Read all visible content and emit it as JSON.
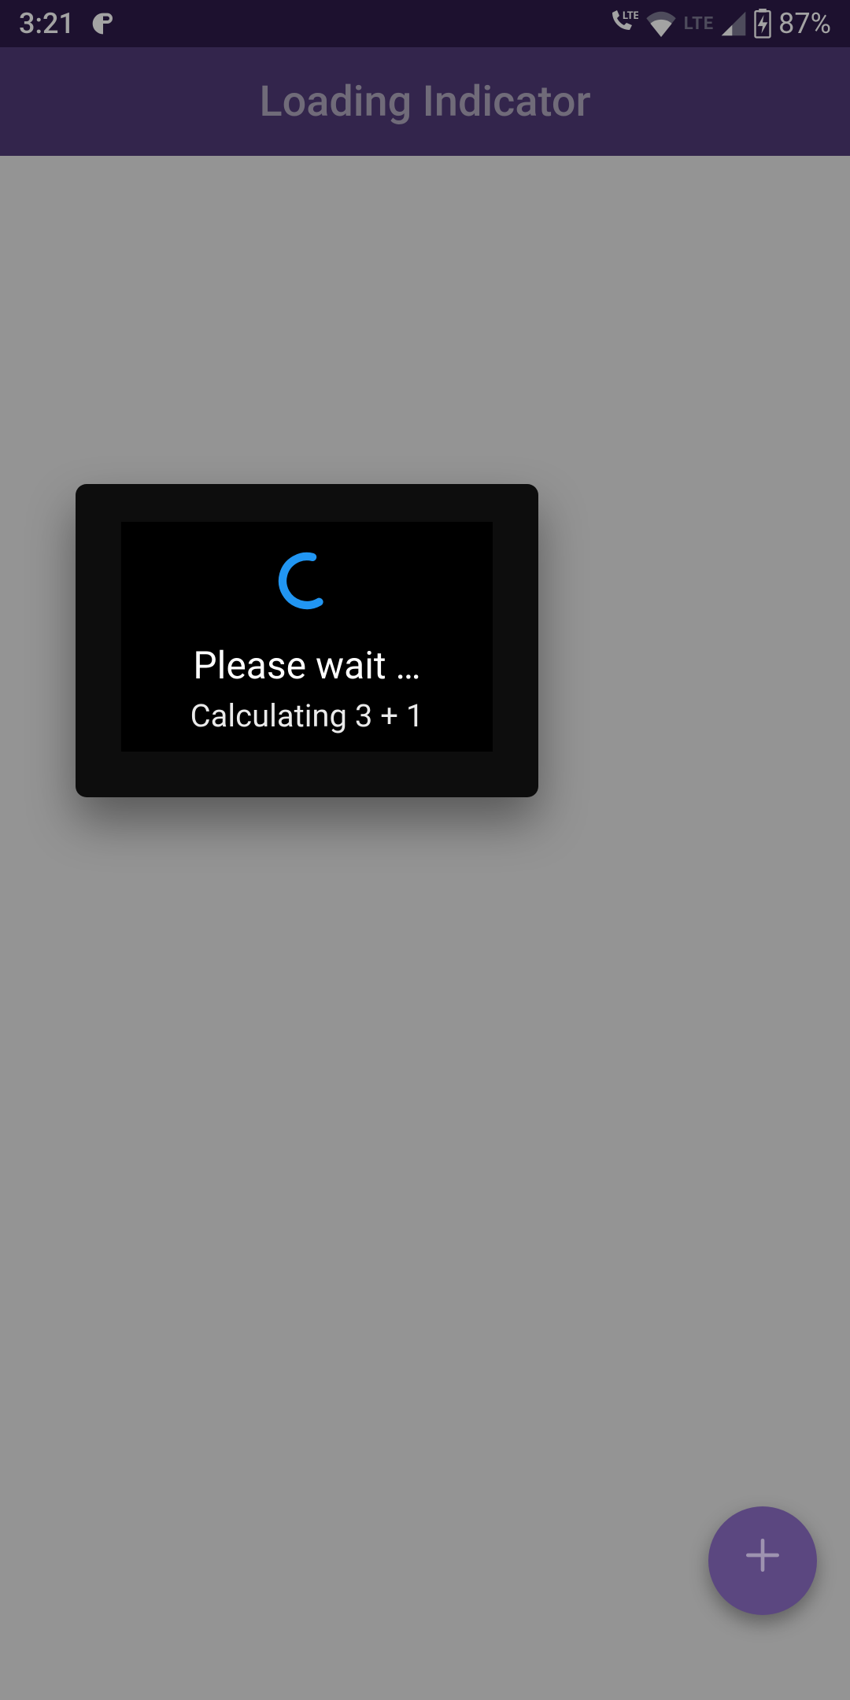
{
  "status": {
    "time": "3:21",
    "battery": "87%",
    "lte_label": "LTE"
  },
  "appbar": {
    "title": "Loading Indicator"
  },
  "dialog": {
    "title": "Please wait …",
    "subtitle": "Calculating 3 + 1"
  },
  "fab": {
    "icon_glyph": "+"
  },
  "colors": {
    "status_bar": "#2e1c4a",
    "app_bar": "#513b78",
    "spinner": "#2196f3",
    "fab": "#5b4780"
  }
}
